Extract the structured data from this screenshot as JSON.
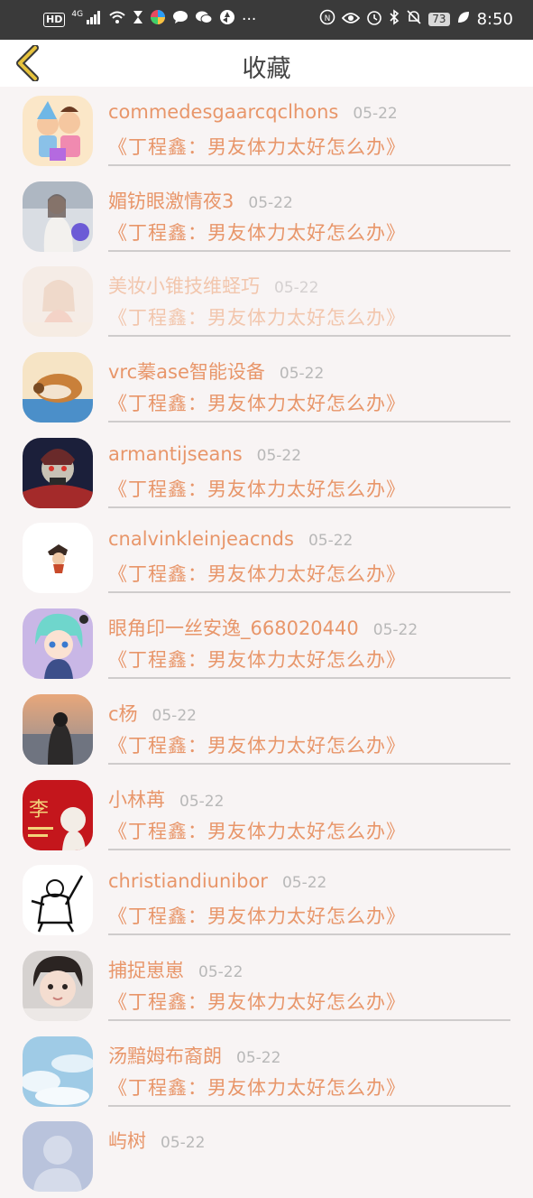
{
  "status_bar": {
    "hd_badge": "HD",
    "network": "4G",
    "more": "···",
    "battery": "73",
    "time": "8:50"
  },
  "header": {
    "title": "收藏"
  },
  "colors": {
    "accent": "#e8966a",
    "date": "#b8b8b8",
    "back_icon": "#e6c23c"
  },
  "favorites": [
    {
      "name": "commedesgaarcqclhons",
      "date": "05-22",
      "title": "《丁程鑫：男友体力太好怎么办》"
    },
    {
      "name": "媚钫眼激情夜3",
      "date": "05-22",
      "title": "《丁程鑫：男友体力太好怎么办》"
    },
    {
      "name": "美妆小锥技维蛏巧",
      "date": "05-22",
      "title": "《丁程鑫：男友体力太好怎么办》"
    },
    {
      "name": "vrc蓁ase智能设备",
      "date": "05-22",
      "title": "《丁程鑫：男友体力太好怎么办》"
    },
    {
      "name": "armantijseans",
      "date": "05-22",
      "title": "《丁程鑫：男友体力太好怎么办》"
    },
    {
      "name": "cnalvinkleinjeacnds",
      "date": "05-22",
      "title": "《丁程鑫：男友体力太好怎么办》"
    },
    {
      "name": "眼角印一丝安逸_668020440",
      "date": "05-22",
      "title": "《丁程鑫：男友体力太好怎么办》"
    },
    {
      "name": "c杨",
      "date": "05-22",
      "title": "《丁程鑫：男友体力太好怎么办》"
    },
    {
      "name": "小林苒",
      "date": "05-22",
      "title": "《丁程鑫：男友体力太好怎么办》",
      "avatar_text": "李"
    },
    {
      "name": "christiandiunibor",
      "date": "05-22",
      "title": "《丁程鑫：男友体力太好怎么办》"
    },
    {
      "name": "捕捉崽崽",
      "date": "05-22",
      "title": "《丁程鑫：男友体力太好怎么办》"
    },
    {
      "name": "汤黯姆布裔朗",
      "date": "05-22",
      "title": "《丁程鑫：男友体力太好怎么办》"
    },
    {
      "name": "屿树",
      "date": "05-22"
    }
  ]
}
